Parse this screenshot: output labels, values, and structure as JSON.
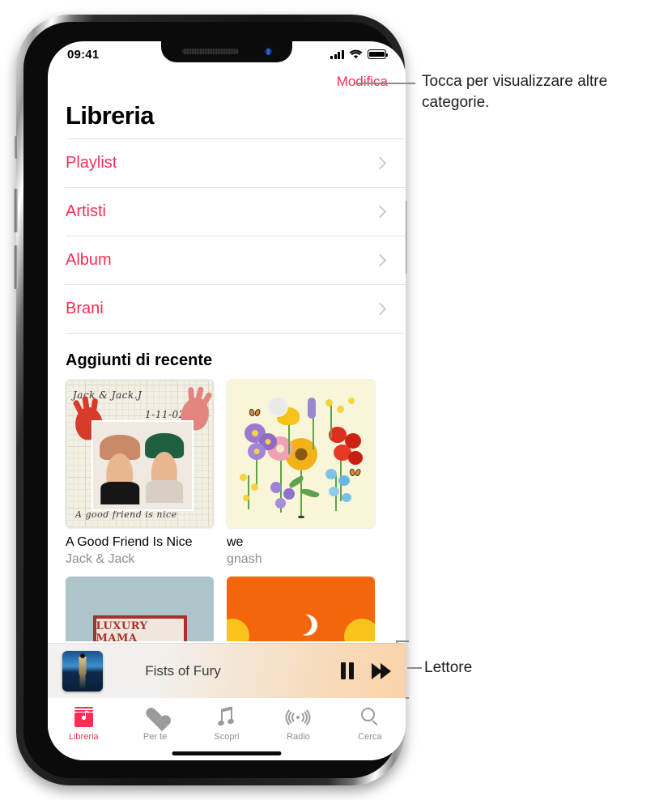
{
  "status_bar": {
    "time": "09:41",
    "cellular_icon": "signal-bars-icon",
    "wifi_icon": "wifi-icon",
    "battery_icon": "battery-icon"
  },
  "nav": {
    "edit_label": "Modifica",
    "page_title": "Libreria"
  },
  "library_rows": [
    {
      "label": "Playlist",
      "chevron": "chevron-right-icon"
    },
    {
      "label": "Artisti",
      "chevron": "chevron-right-icon"
    },
    {
      "label": "Album",
      "chevron": "chevron-right-icon"
    },
    {
      "label": "Brani",
      "chevron": "chevron-right-icon"
    }
  ],
  "recently_added": {
    "section_title": "Aggiunti di recente",
    "albums": [
      {
        "title": "A Good Friend Is Nice",
        "artist": "Jack & Jack",
        "art_text_top": "Jack & Jack.J",
        "art_text_date": "1-11-02",
        "art_text_bottom": "A good friend is nice"
      },
      {
        "title": "we",
        "artist": "gnash"
      }
    ],
    "albums_partial": [
      {
        "art_label": "LUXURY MAMA"
      },
      {
        "art_label": ""
      }
    ]
  },
  "mini_player": {
    "artwork": "album-artwork",
    "track_title": "Fists of Fury",
    "pause_icon": "pause-icon",
    "next_icon": "fast-forward-icon"
  },
  "tab_bar": {
    "tabs": [
      {
        "label": "Libreria",
        "icon": "library-icon",
        "active": true
      },
      {
        "label": "Per te",
        "icon": "heart-icon",
        "active": false
      },
      {
        "label": "Scopri",
        "icon": "music-note-icon",
        "active": false
      },
      {
        "label": "Radio",
        "icon": "radio-waves-icon",
        "active": false
      },
      {
        "label": "Cerca",
        "icon": "search-icon",
        "active": false
      }
    ]
  },
  "callouts": [
    {
      "text": "Tocca per visualizzare altre categorie."
    },
    {
      "text": "Lettore"
    }
  ],
  "colors": {
    "accent": "#fa2d55",
    "secondary_text": "#8e8e93",
    "separator": "#e3e3e3",
    "callout_line": "#8a8a8a"
  }
}
